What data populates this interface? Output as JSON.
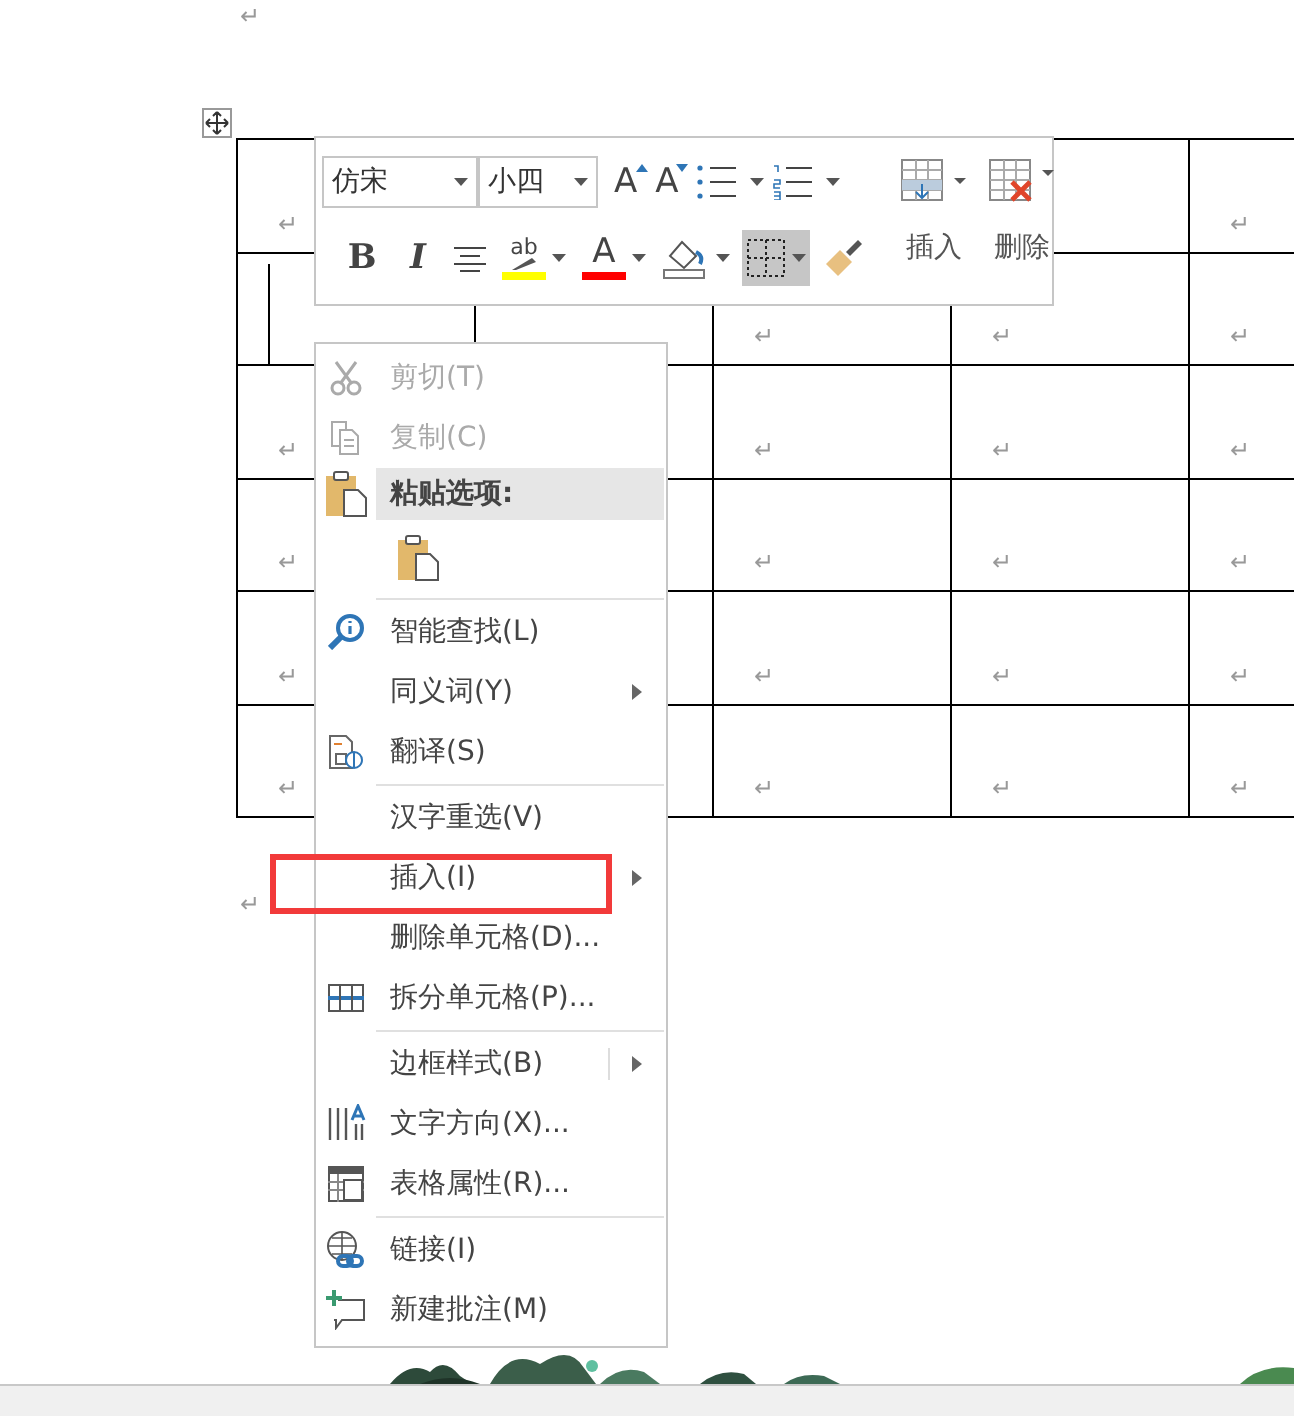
{
  "document": {
    "mark_before": "↵",
    "mark_after": "↵"
  },
  "table": {
    "rows": [
      {
        "cells": [
          {
            "mark": "↵"
          },
          null,
          null,
          {
            "kind": "empty"
          },
          {
            "mark": "↵"
          }
        ]
      },
      {
        "cells": [
          {
            "cursor": true
          },
          {
            "kind": "empty"
          },
          {
            "mark": "↵"
          },
          {
            "mark": "↵"
          },
          {
            "mark": "↵"
          }
        ]
      },
      {
        "cells": [
          {
            "mark": "↵"
          },
          {
            "kind": "empty"
          },
          {
            "mark": "↵"
          },
          {
            "mark": "↵"
          },
          {
            "mark": "↵"
          }
        ]
      },
      {
        "cells": [
          {
            "mark": "↵"
          },
          {
            "kind": "empty"
          },
          {
            "mark": "↵"
          },
          {
            "mark": "↵"
          },
          {
            "mark": "↵"
          }
        ]
      },
      {
        "cells": [
          {
            "mark": "↵"
          },
          {
            "kind": "empty"
          },
          {
            "mark": "↵"
          },
          {
            "mark": "↵"
          },
          {
            "mark": "↵"
          }
        ]
      },
      {
        "cells": [
          {
            "mark": "↵"
          },
          {
            "kind": "empty"
          },
          {
            "mark": "↵"
          },
          {
            "mark": "↵"
          },
          {
            "mark": "↵"
          }
        ]
      }
    ]
  },
  "toolbar": {
    "font_name": "仿宋",
    "font_size": "小四",
    "row_1": [
      {
        "kind": "grow",
        "label": "A",
        "selected": false
      },
      {
        "kind": "shrink",
        "label": "A",
        "selected": false
      },
      {
        "kind": "bullets",
        "selected": false
      },
      {
        "kind": "numbering",
        "selected": false
      }
    ],
    "row_2": [
      {
        "kind": "bold",
        "label": "B",
        "selected": false
      },
      {
        "kind": "italic",
        "label": "I",
        "selected": false
      },
      {
        "kind": "center",
        "selected": false
      },
      {
        "kind": "highlight",
        "label": "ab",
        "color": "#ffff00",
        "selected": false
      },
      {
        "kind": "font-color",
        "label": "A",
        "color": "#ff0000",
        "selected": false
      },
      {
        "kind": "shading",
        "selected": false
      },
      {
        "kind": "borders",
        "selected": true
      },
      {
        "kind": "painter",
        "selected": false
      }
    ],
    "table_buttons": [
      {
        "kind": "insert",
        "label": "插入"
      },
      {
        "kind": "delete",
        "label": "删除"
      }
    ]
  },
  "context_menu": {
    "items": [
      {
        "kind": "command",
        "label": "剪切(T)",
        "disabled": true,
        "submenu": false,
        "annotated": false
      },
      {
        "kind": "command",
        "label": "复制(C)",
        "disabled": true,
        "submenu": false,
        "annotated": false
      },
      {
        "kind": "header",
        "label": "粘贴选项:"
      },
      {
        "kind": "paste"
      },
      {
        "kind": "separator"
      },
      {
        "kind": "command",
        "label": "智能查找(L)",
        "disabled": false,
        "submenu": false,
        "annotated": false
      },
      {
        "kind": "command",
        "label": "同义词(Y)",
        "disabled": false,
        "submenu": true,
        "annotated": false
      },
      {
        "kind": "command",
        "label": "翻译(S)",
        "disabled": false,
        "submenu": false,
        "annotated": false
      },
      {
        "kind": "separator"
      },
      {
        "kind": "command",
        "label": "汉字重选(V)",
        "disabled": false,
        "submenu": false,
        "annotated": false
      },
      {
        "kind": "command",
        "label": "插入(I)",
        "disabled": false,
        "submenu": true,
        "annotated": true
      },
      {
        "kind": "command",
        "label": "删除单元格(D)...",
        "disabled": false,
        "submenu": false,
        "annotated": false
      },
      {
        "kind": "command",
        "label": "拆分单元格(P)...",
        "disabled": false,
        "submenu": false,
        "annotated": false
      },
      {
        "kind": "separator"
      },
      {
        "kind": "split",
        "label": "边框样式(B)",
        "disabled": false,
        "submenu": true,
        "annotated": false
      },
      {
        "kind": "command",
        "label": "文字方向(X)...",
        "disabled": false,
        "submenu": false,
        "annotated": false
      },
      {
        "kind": "command",
        "label": "表格属性(R)...",
        "disabled": false,
        "submenu": false,
        "annotated": false
      },
      {
        "kind": "separator"
      },
      {
        "kind": "command",
        "label": "链接(I)",
        "disabled": false,
        "submenu": false,
        "annotated": false
      },
      {
        "kind": "command",
        "label": "新建批注(M)",
        "disabled": false,
        "submenu": false,
        "annotated": false
      }
    ]
  }
}
